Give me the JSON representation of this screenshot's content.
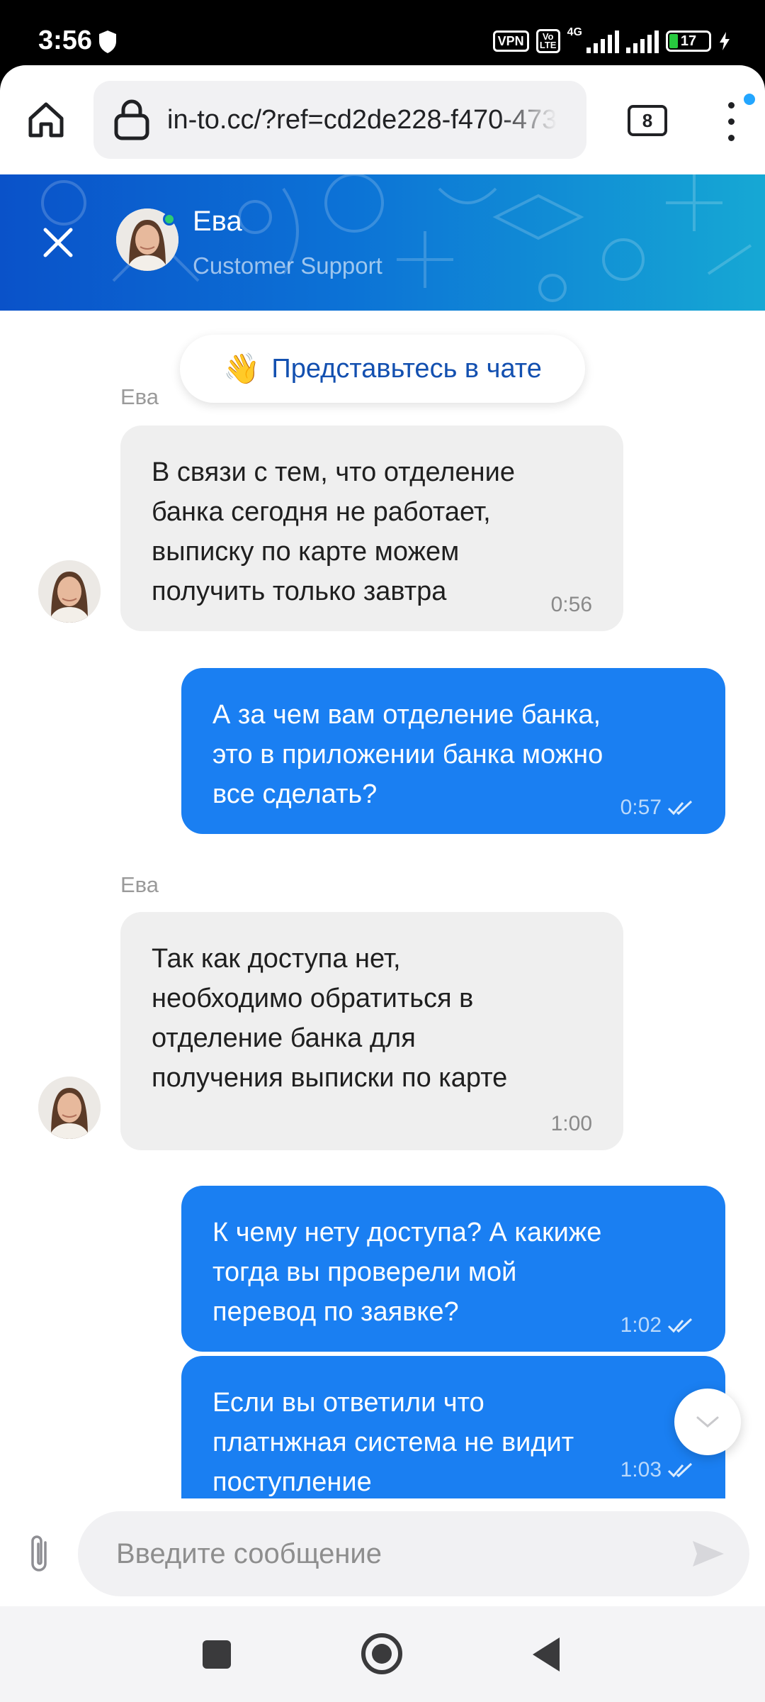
{
  "status_bar": {
    "time": "3:56",
    "vpn": "VPN",
    "volte": "Vo LTE",
    "network": "4G",
    "battery": "17"
  },
  "browser": {
    "url": "in-to.cc/?ref=cd2de228-f470-473",
    "tab_count": "8"
  },
  "chat_header": {
    "agent_name": "Ева",
    "agent_role": "Customer Support"
  },
  "intro": {
    "label": "Представьтесь в чате",
    "icon": "waving-hand-icon"
  },
  "messages": [
    {
      "direction": "in",
      "sender": "Ева",
      "lines": [
        "В связи с тем, что отделение",
        "банка сегодня не работает,",
        "выписку по карте можем",
        "получить только завтра"
      ],
      "time": "0:56"
    },
    {
      "direction": "out",
      "lines": [
        "А за чем вам отделение банка,",
        "это в приложении банка можно",
        "все сделать?"
      ],
      "time": "0:57"
    },
    {
      "direction": "in",
      "sender": "Ева",
      "lines": [
        "Так как доступа нет,",
        "необходимо обратиться в",
        "отделение банка для",
        "получения выписки по карте"
      ],
      "time": "1:00"
    },
    {
      "direction": "out",
      "lines": [
        "К чему нету доступа? А какиже",
        "тогда вы проверели мой",
        "перевод по заявке?"
      ],
      "time": "1:02"
    },
    {
      "direction": "out",
      "lines": [
        "Если вы ответили что",
        "платнжная система не видит",
        "поступление"
      ],
      "time": "1:03"
    }
  ],
  "composer": {
    "placeholder": "Введите сообщение"
  },
  "colors": {
    "header_start": "#0a52c9",
    "header_end": "#16a8d4",
    "outgoing_bubble": "#1a7ff2",
    "incoming_bubble": "#efefef"
  }
}
